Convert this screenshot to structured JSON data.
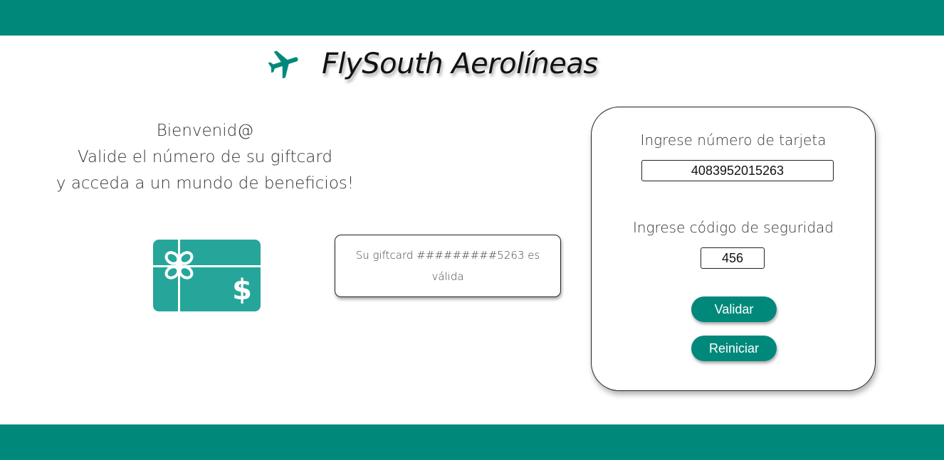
{
  "brand": {
    "title": "FlySouth Aerolíneas",
    "icon": "airplane-icon",
    "color": "#00897b"
  },
  "welcome": {
    "line1": "Bienvenid@",
    "line2": "Valide el número de su giftcard",
    "line3": "y acceda a un mundo de beneficios!"
  },
  "giftcard_icon": "giftcard-dollar-icon",
  "result": {
    "message": "Su giftcard #########5263 es válida"
  },
  "form": {
    "card_number_label": "Ingrese número de tarjeta",
    "card_number_value": "4083952015263",
    "security_code_label": "Ingrese código de seguridad",
    "security_code_value": "456",
    "validate_label": "Validar",
    "reset_label": "Reiniciar"
  },
  "colors": {
    "accent": "#00897b",
    "icon": "#26a69a"
  }
}
